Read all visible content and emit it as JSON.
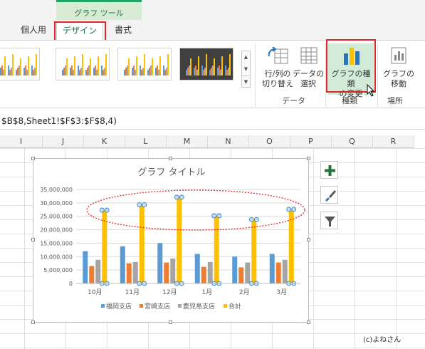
{
  "ribbon": {
    "tool_group_label": "グラフ ツール",
    "tabs": [
      {
        "label": "個人用"
      },
      {
        "label": "デザイン",
        "active": true
      },
      {
        "label": "書式"
      }
    ],
    "buttons": {
      "switch_row_col": [
        "行/列の",
        "切り替え"
      ],
      "select_data": [
        "データの",
        "選択"
      ],
      "change_type": [
        "グラフの種類",
        "の変更"
      ],
      "move_chart": [
        "グラフの",
        "移動"
      ]
    },
    "groups": {
      "data": "データ",
      "type": "種類",
      "location": "場所"
    }
  },
  "formula_bar": {
    "text": "$B$8,Sheet1!$F$3:$F$8,4)"
  },
  "columns": [
    "I",
    "J",
    "K",
    "L",
    "M",
    "N",
    "O",
    "P",
    "Q",
    "R"
  ],
  "chart_data": {
    "type": "bar",
    "title": "グラフ タイトル",
    "categories": [
      "10月",
      "11月",
      "12月",
      "1月",
      "2月",
      "3月"
    ],
    "y_ticks": [
      "35,000,000",
      "30,000,000",
      "25,000,000",
      "20,000,000",
      "15,000,000",
      "10,000,000",
      "5,000,000",
      "0"
    ],
    "ylim": [
      0,
      35000000
    ],
    "legend_position": "bottom",
    "series": [
      {
        "name": "福岡支店",
        "color": "#5b9bd5",
        "values": [
          12000000,
          13800000,
          15000000,
          11000000,
          10000000,
          11000000
        ]
      },
      {
        "name": "宮崎支店",
        "color": "#ed7d31",
        "values": [
          6500000,
          7500000,
          7800000,
          6200000,
          6000000,
          7800000
        ]
      },
      {
        "name": "鹿児島支店",
        "color": "#a5a5a5",
        "values": [
          8800000,
          8000000,
          9300000,
          8000000,
          7800000,
          8800000
        ]
      },
      {
        "name": "合計",
        "color": "#ffc000",
        "values": [
          27300000,
          29300000,
          32100000,
          25200000,
          23800000,
          27600000
        ]
      }
    ]
  },
  "credit": "(c)よねさん"
}
